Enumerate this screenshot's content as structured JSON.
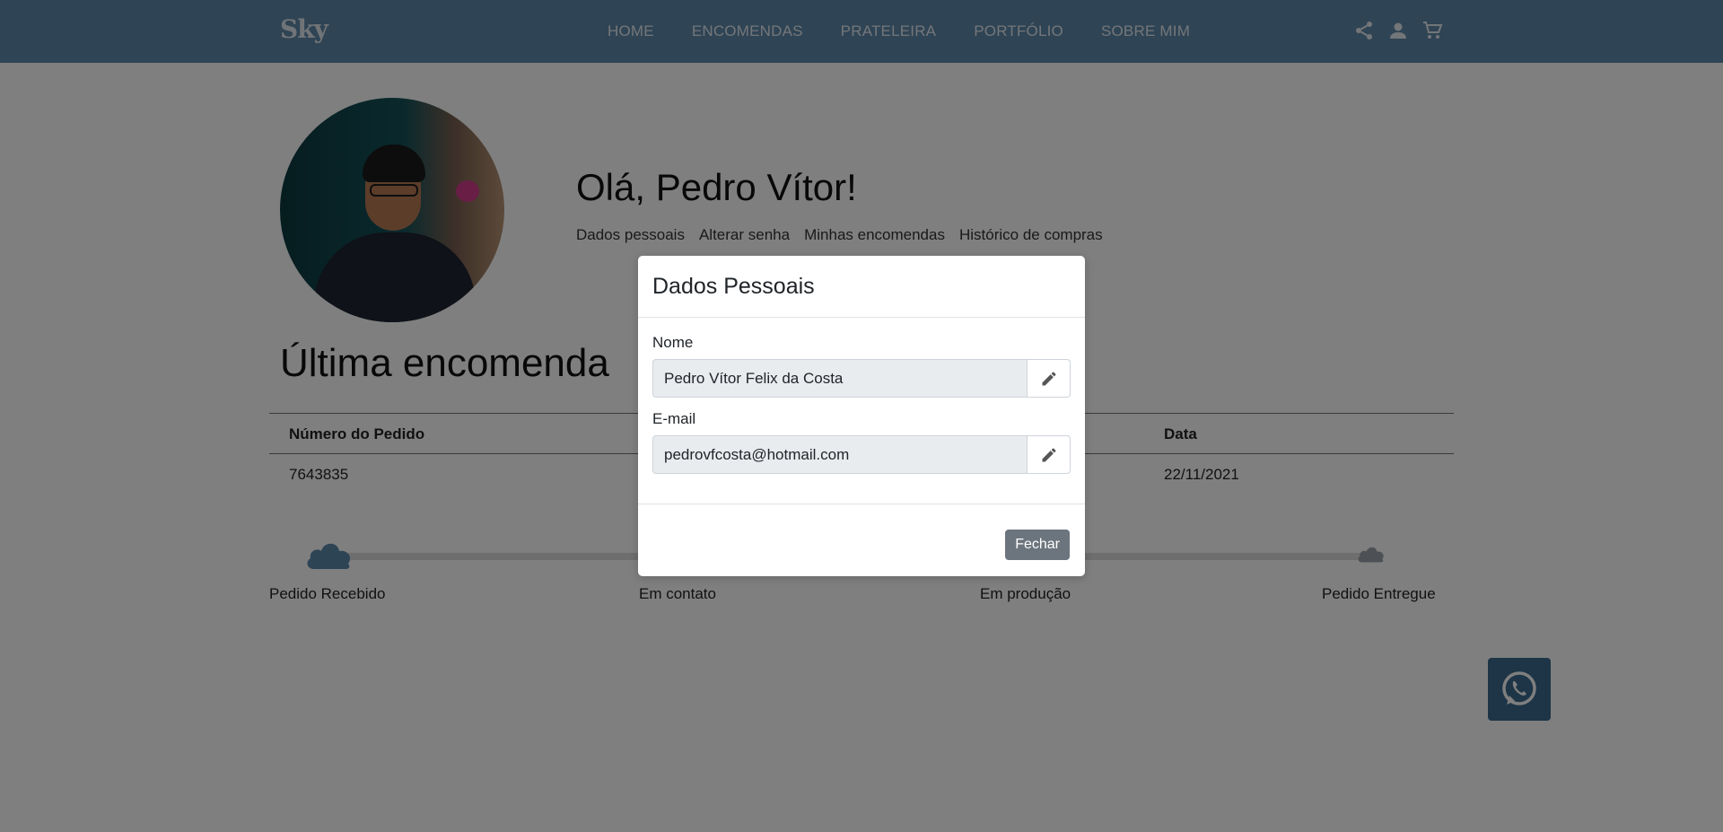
{
  "navbar": {
    "logo": "Sky",
    "links": [
      "HOME",
      "ENCOMENDAS",
      "PRATELEIRA",
      "PORTFÓLIO",
      "SOBRE MIM"
    ],
    "icons": [
      "share-icon",
      "user-icon",
      "cart-icon"
    ]
  },
  "profile": {
    "greeting": "Olá, Pedro Vítor!",
    "links": [
      "Dados pessoais",
      "Alterar senha",
      "Minhas encomendas",
      "Histórico de compras"
    ]
  },
  "last_order": {
    "title": "Última encomenda",
    "columns": [
      "Número do Pedido",
      "Data"
    ],
    "row": {
      "number": "7643835",
      "date": "22/11/2021"
    },
    "steps": [
      "Pedido Recebido",
      "Em contato",
      "Em produção",
      "Pedido Entregue"
    ]
  },
  "modal": {
    "title": "Dados Pessoais",
    "name_label": "Nome",
    "name_value": "Pedro Vítor Felix da Costa",
    "email_label": "E-mail",
    "email_value": "pedrovfcosta@hotmail.com",
    "close_label": "Fechar"
  },
  "colors": {
    "navbar": "#5e88a8",
    "accent": "#5a89ab",
    "whatsapp_button": "#3b6b8c"
  }
}
